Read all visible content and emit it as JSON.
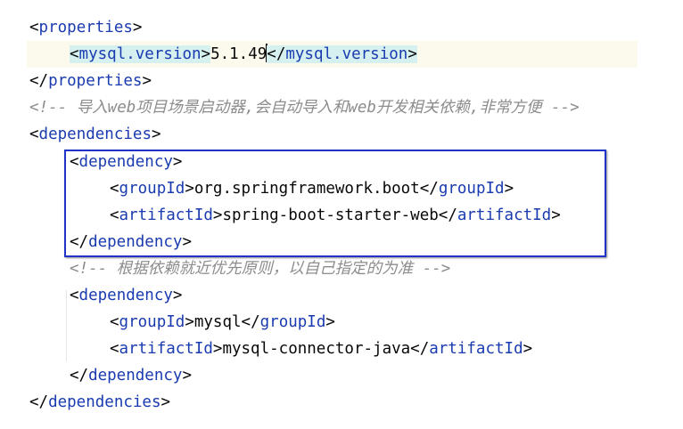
{
  "editor": {
    "lines": [
      {
        "id": "properties-open",
        "tag": "properties"
      },
      {
        "id": "mysql-version",
        "tag": "mysql.version",
        "value_before_caret": "5.1.49",
        "value_after_caret": ""
      },
      {
        "id": "properties-close",
        "tag": "properties"
      },
      {
        "id": "comment-1",
        "text": "<!-- 导入web项目场景启动器,会自动导入和web开发相关依赖,非常方便 -->"
      },
      {
        "id": "dependencies-open",
        "tag": "dependencies"
      },
      {
        "id": "dependency-1-open",
        "tag": "dependency"
      },
      {
        "id": "groupid-1",
        "tag": "groupId",
        "value": "org.springframework.boot"
      },
      {
        "id": "artifactid-1",
        "tag": "artifactId",
        "value": "spring-boot-starter-web"
      },
      {
        "id": "dependency-1-close",
        "tag": "dependency"
      },
      {
        "id": "comment-2",
        "text": "<!-- 根据依赖就近优先原则，以自己指定的为准 -->"
      },
      {
        "id": "dependency-2-open",
        "tag": "dependency"
      },
      {
        "id": "groupid-2",
        "tag": "groupId",
        "value": "mysql"
      },
      {
        "id": "artifactid-2",
        "tag": "artifactId",
        "value": "mysql-connector-java"
      },
      {
        "id": "dependency-2-close",
        "tag": "dependency"
      },
      {
        "id": "dependencies-close",
        "tag": "dependencies"
      }
    ]
  },
  "syntax_colors": {
    "tag": "#1a3bb0",
    "bracket": "#080808",
    "text": "#080808",
    "comment": "#8c8c8c",
    "tag_highlight": "#d6f0f0",
    "caret_line": "#fcfaed",
    "annotation_box": "#2033c8"
  },
  "punct": {
    "lt": "<",
    "gt": ">",
    "lt_slash": "</"
  }
}
